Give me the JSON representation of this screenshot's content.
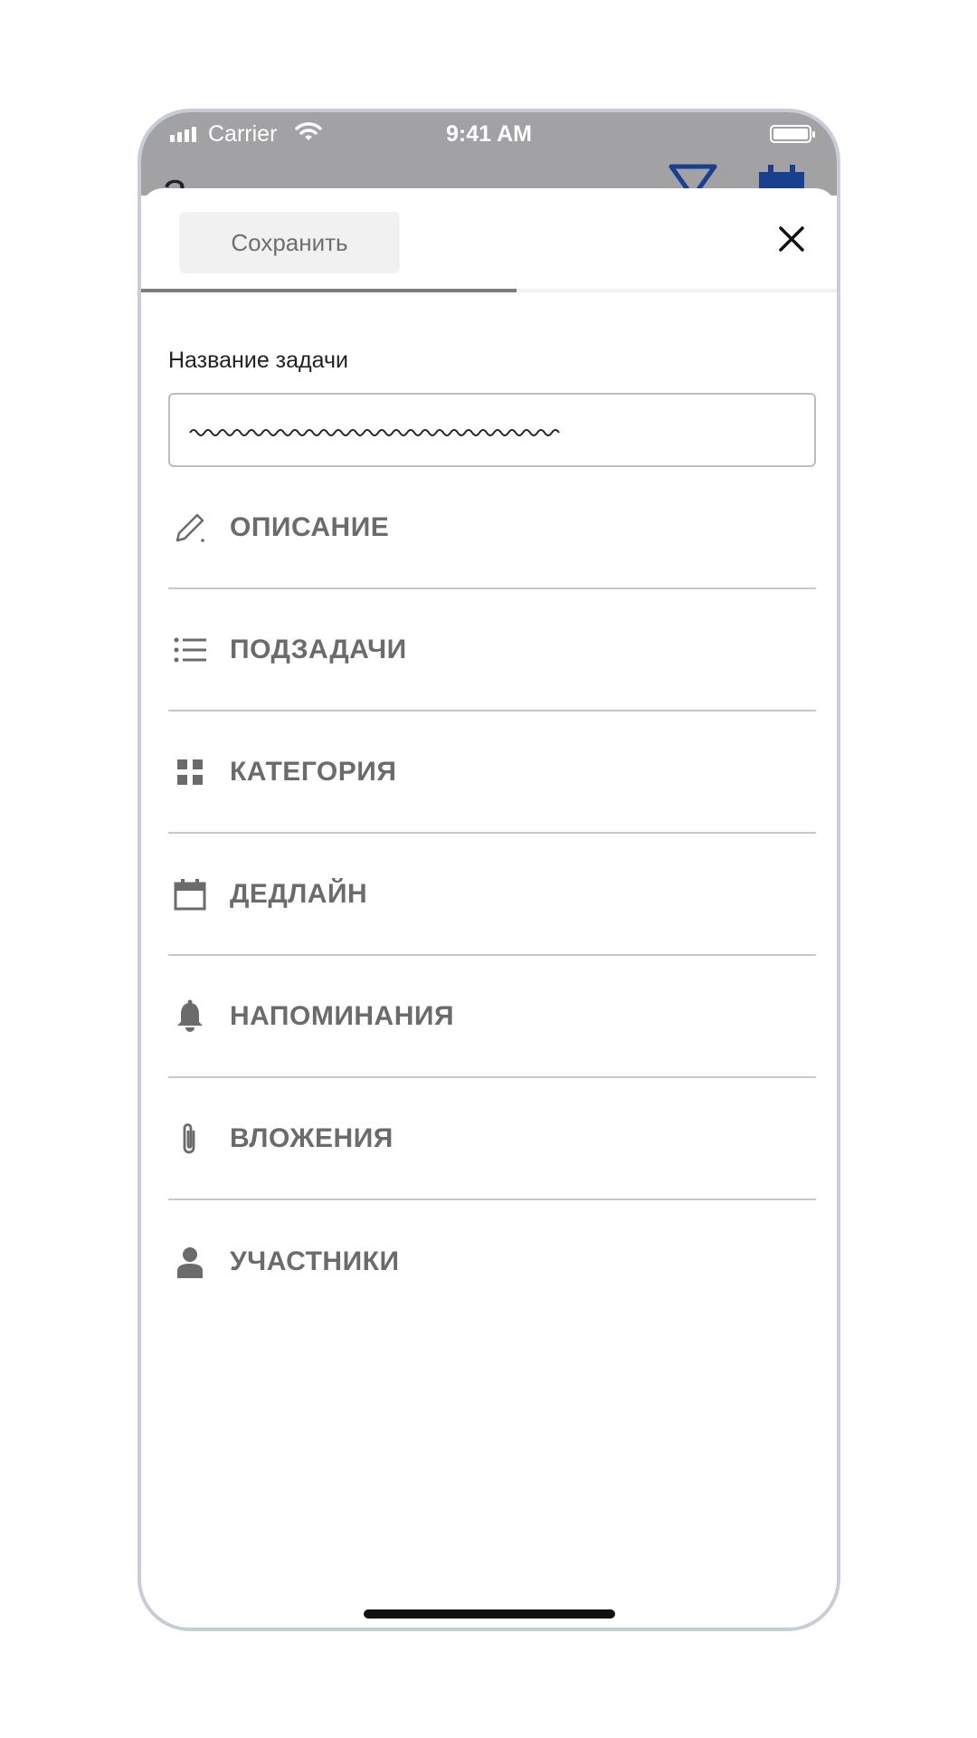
{
  "status_bar": {
    "carrier": "Carrier",
    "time": "9:41 AM",
    "background": "#a2a2a4"
  },
  "behind": {
    "title_fragment": "З",
    "accent_color": "#1a3f8f"
  },
  "toolbar": {
    "save_label": "Сохранить",
    "close_icon": "close-icon",
    "progress_fraction": 0.54
  },
  "form": {
    "title_label": "Название задачи",
    "title_value_note": "scribbled placeholder text"
  },
  "menu": {
    "items": [
      {
        "label": "ОПИСАНИЕ",
        "icon": "pencil-icon"
      },
      {
        "label": "ПОДЗАДАЧИ",
        "icon": "list-icon"
      },
      {
        "label": "КАТЕГОРИЯ",
        "icon": "grid-icon"
      },
      {
        "label": "ДЕДЛАЙН",
        "icon": "calendar-icon"
      },
      {
        "label": "НАПОМИНАНИЯ",
        "icon": "bell-icon"
      },
      {
        "label": "ВЛОЖЕНИЯ",
        "icon": "paperclip-icon"
      },
      {
        "label": "УЧАСТНИКИ",
        "icon": "person-icon"
      }
    ]
  }
}
